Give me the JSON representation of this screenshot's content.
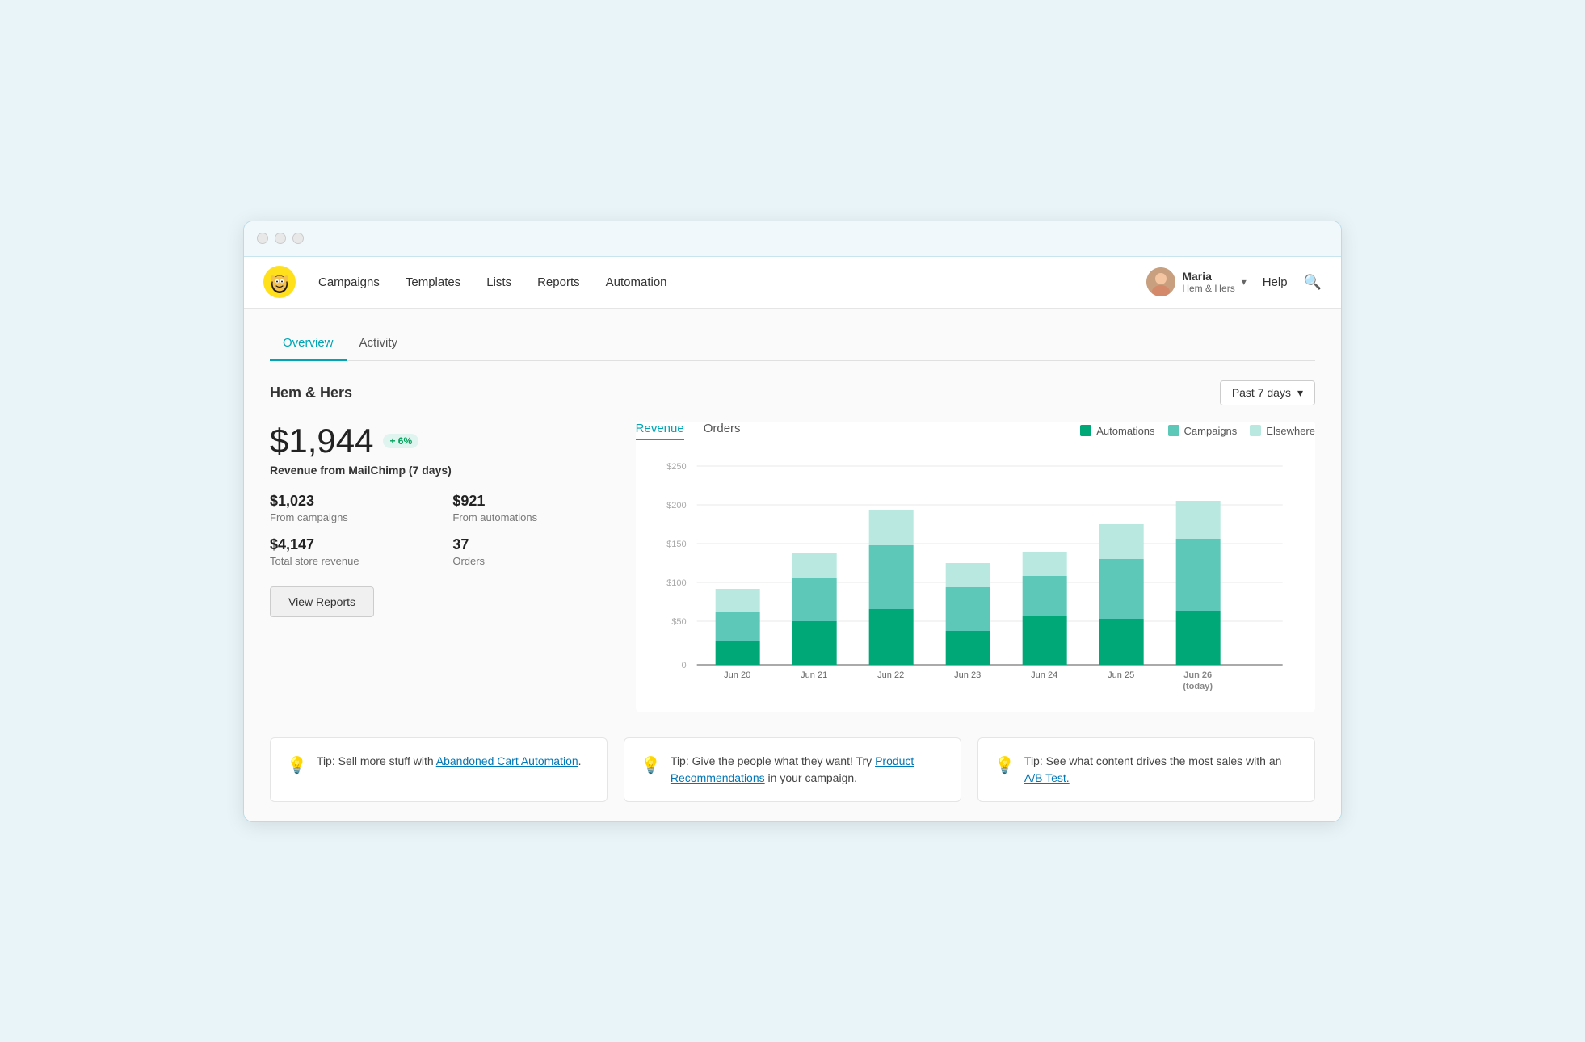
{
  "window": {
    "titlebar_buttons": [
      "close",
      "minimize",
      "maximize"
    ]
  },
  "navbar": {
    "logo_alt": "MailChimp logo",
    "nav_items": [
      {
        "label": "Campaigns",
        "id": "campaigns"
      },
      {
        "label": "Templates",
        "id": "templates"
      },
      {
        "label": "Lists",
        "id": "lists"
      },
      {
        "label": "Reports",
        "id": "reports"
      },
      {
        "label": "Automation",
        "id": "automation"
      }
    ],
    "user": {
      "name": "Maria",
      "org": "Hem & Hers",
      "avatar_emoji": "👩"
    },
    "help_label": "Help"
  },
  "tabs": [
    {
      "label": "Overview",
      "active": true
    },
    {
      "label": "Activity",
      "active": false
    }
  ],
  "section": {
    "title": "Hem & Hers",
    "date_range": "Past 7 days"
  },
  "stats": {
    "revenue": "$1,944",
    "revenue_change": "+ 6%",
    "revenue_label": "Revenue from MailChimp (7 days)",
    "from_campaigns_value": "$1,023",
    "from_campaigns_label": "From campaigns",
    "from_automations_value": "$921",
    "from_automations_label": "From automations",
    "total_store_value": "$4,147",
    "total_store_label": "Total store revenue",
    "orders_value": "37",
    "orders_label": "Orders"
  },
  "view_reports_label": "View Reports",
  "chart": {
    "tabs": [
      {
        "label": "Revenue",
        "active": true
      },
      {
        "label": "Orders",
        "active": false
      }
    ],
    "legend": [
      {
        "label": "Automations",
        "color": "#00a878"
      },
      {
        "label": "Campaigns",
        "color": "#5dc8b8"
      },
      {
        "label": "Elsewhere",
        "color": "#b8e8e0"
      }
    ],
    "y_axis": [
      "$250",
      "$200",
      "$150",
      "$100",
      "$50",
      "0"
    ],
    "bars": [
      {
        "label": "Jun 20",
        "automations": 30,
        "campaigns": 35,
        "elsewhere": 30
      },
      {
        "label": "Jun 21",
        "automations": 55,
        "campaigns": 55,
        "elsewhere": 30
      },
      {
        "label": "Jun 22",
        "automations": 70,
        "campaigns": 80,
        "elsewhere": 45
      },
      {
        "label": "Jun 23",
        "automations": 42,
        "campaigns": 55,
        "elsewhere": 30
      },
      {
        "label": "Jun 24",
        "automations": 60,
        "campaigns": 50,
        "elsewhere": 30
      },
      {
        "label": "Jun 25",
        "automations": 58,
        "campaigns": 75,
        "elsewhere": 45
      },
      {
        "label": "Jun 26 (today)",
        "automations": 68,
        "campaigns": 90,
        "elsewhere": 48
      }
    ]
  },
  "tips": [
    {
      "icon": "💡",
      "text_before": "Tip: Sell more stuff with ",
      "link_text": "Abandoned Cart Automation",
      "text_after": "."
    },
    {
      "icon": "💡",
      "text_before": "Tip: Give the people what they want! Try ",
      "link_text": "Product Recommendations",
      "text_after": " in your campaign."
    },
    {
      "icon": "💡",
      "text_before": "Tip: See what content drives the most sales with an ",
      "link_text": "A/B Test.",
      "text_after": ""
    }
  ]
}
